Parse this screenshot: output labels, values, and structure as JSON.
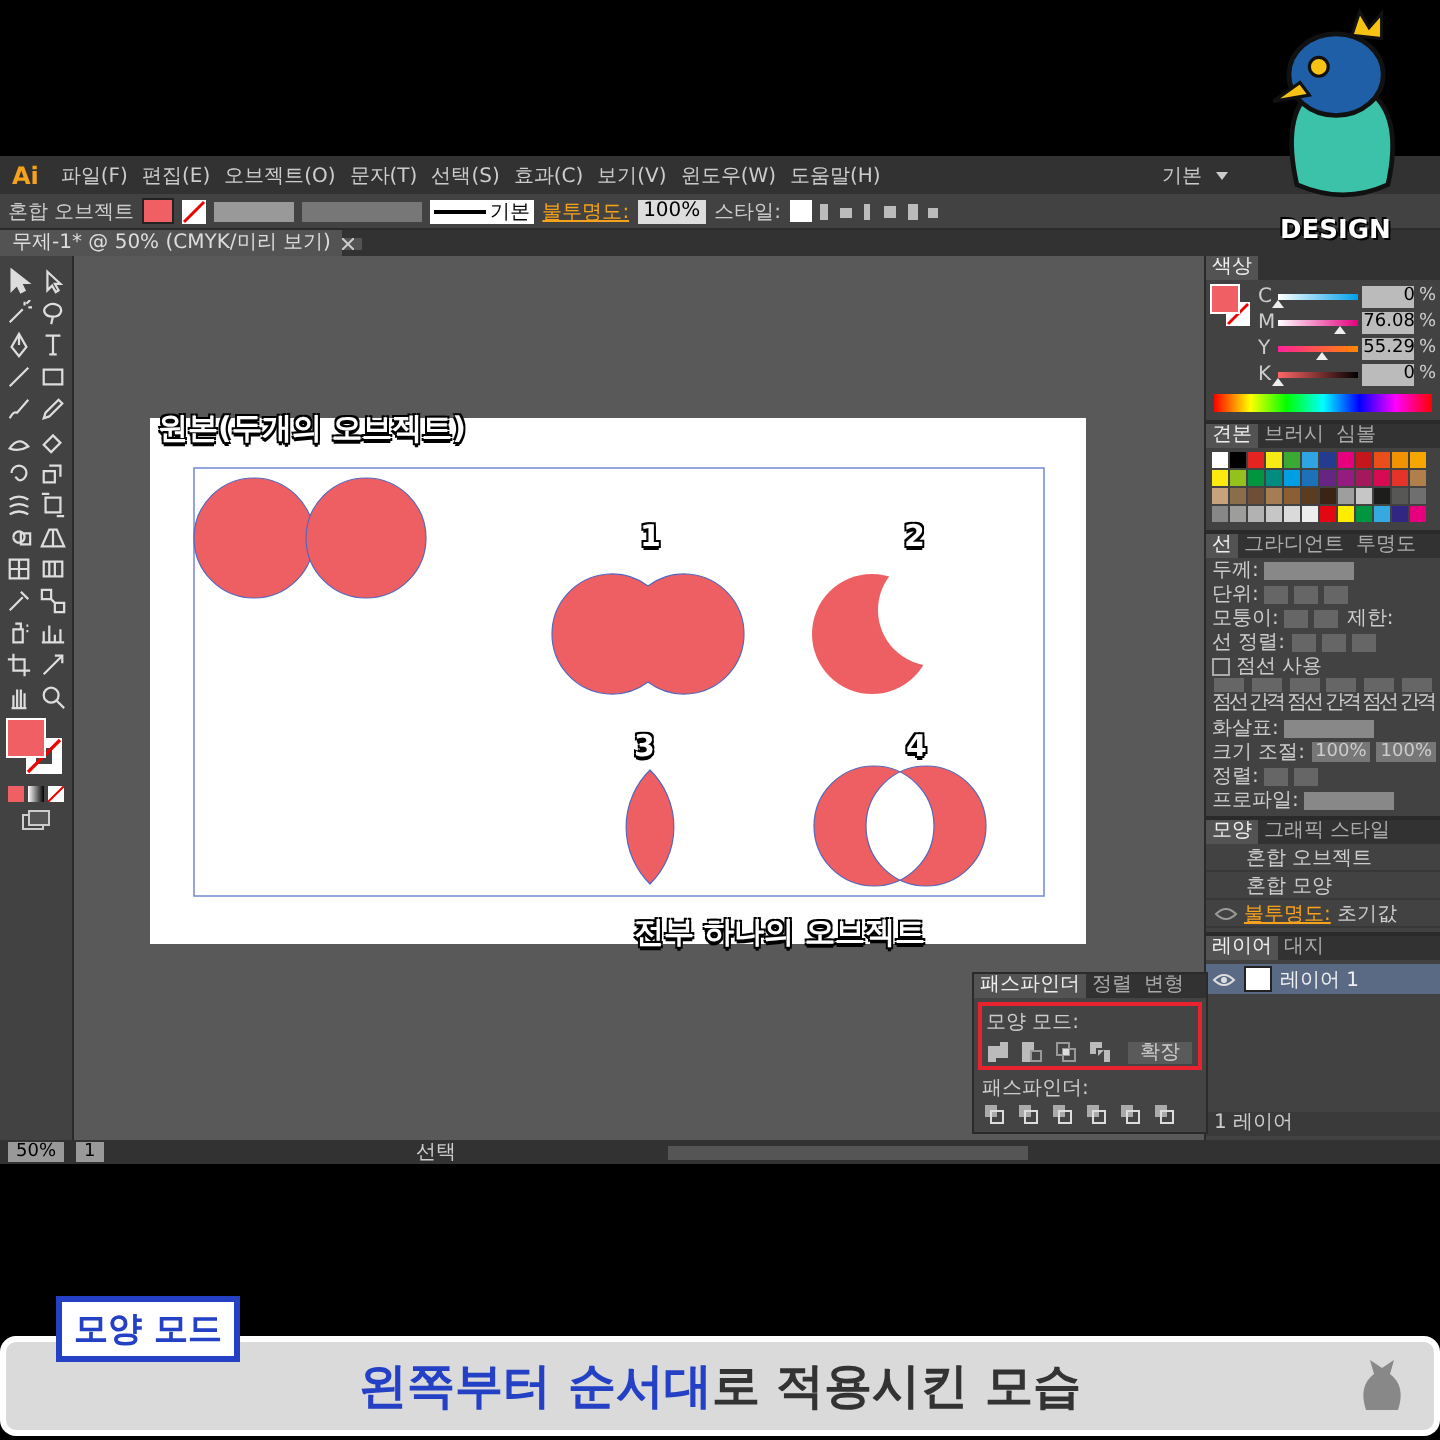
{
  "menu_bar": {
    "logo": "Ai",
    "items": [
      "파일(F)",
      "편집(E)",
      "오브젝트(O)",
      "문자(T)",
      "선택(S)",
      "효과(C)",
      "보기(V)",
      "윈도우(W)",
      "도움말(H)"
    ],
    "workspace": "기본"
  },
  "control_bar": {
    "object_type": "혼합 오브젝트",
    "stroke_profile": "기본",
    "opacity_label": "불투명도:",
    "opacity": "100%",
    "style_label": "스타일:"
  },
  "document_tab": {
    "title": "무제-1* @ 50% (CMYK/미리 보기)"
  },
  "artboard": {
    "title": "원본(두개의 오브젝트)",
    "caption": "전부 하나의 오브젝트",
    "shapes": [
      {
        "kind": "original"
      },
      {
        "kind": "unite",
        "label": "1"
      },
      {
        "kind": "minus_front",
        "label": "2"
      },
      {
        "kind": "intersect",
        "label": "3"
      },
      {
        "kind": "exclude",
        "label": "4"
      }
    ]
  },
  "color_panel": {
    "tab": "색상",
    "channels": [
      {
        "name": "C",
        "level": 0.0,
        "value": "0",
        "unit": "%"
      },
      {
        "name": "M",
        "level": 0.76,
        "value": "76.08",
        "unit": "%"
      },
      {
        "name": "Y",
        "level": 0.55,
        "value": "55.29",
        "unit": "%"
      },
      {
        "name": "K",
        "level": 0.0,
        "value": "0",
        "unit": "%"
      }
    ]
  },
  "swatches_panel": {
    "tabs": [
      {
        "label": "견본",
        "selected": true
      },
      {
        "label": "브러시",
        "selected": false
      },
      {
        "label": "심볼",
        "selected": false
      }
    ]
  },
  "stroke_panel": {
    "tabs": [
      {
        "label": "선",
        "selected": true
      },
      {
        "label": "그라디언트",
        "selected": false
      },
      {
        "label": "투명도",
        "selected": false
      }
    ],
    "weight_label": "두께:",
    "cap_label": "단위:",
    "corner_label": "모퉁이:",
    "limit_label": "제한:",
    "align_label": "선 정렬:",
    "dashed": {
      "label": "점선 사용",
      "checked": false
    },
    "dash_labels": [
      "점선",
      "간격",
      "점선",
      "간격",
      "점선",
      "간격"
    ],
    "arrow_label": "화살표:",
    "scale_label": "크기 조절:",
    "scale_values": [
      "100%",
      "100%"
    ],
    "arrow_align_label": "정렬:",
    "profile_label": "프로파일:"
  },
  "appearance_panel": {
    "tabs": [
      {
        "label": "모양",
        "selected": true
      },
      {
        "label": "그래픽 스타일",
        "selected": false
      }
    ],
    "rows": [
      "혼합 오브젝트",
      "혼합 모양"
    ],
    "opacity_link": "불투명도:",
    "opacity_value": "초기값"
  },
  "layers_panel": {
    "tabs": [
      {
        "label": "레이어",
        "selected": true
      },
      {
        "label": "대지",
        "selected": false
      }
    ],
    "layers": [
      {
        "name": "레이어 1",
        "visible": true
      }
    ],
    "footer": "1 레이어"
  },
  "pathfinder_panel": {
    "tabs": [
      {
        "label": "패스파인더",
        "selected": true
      },
      {
        "label": "정렬",
        "selected": false
      },
      {
        "label": "변형",
        "selected": false
      }
    ],
    "shape_modes_label": "모양 모드:",
    "expand_button": "확장",
    "pathfinders_label": "패스파인더:"
  },
  "status_bar": {
    "zoom": "50%",
    "artboard": "1",
    "tool": "선택"
  },
  "mascot": {
    "label": "DESIGN"
  },
  "badge": "모양 모드",
  "caption": {
    "highlight": "왼쪽부터 순서대",
    "rest": "로 적용시킨 모습"
  }
}
